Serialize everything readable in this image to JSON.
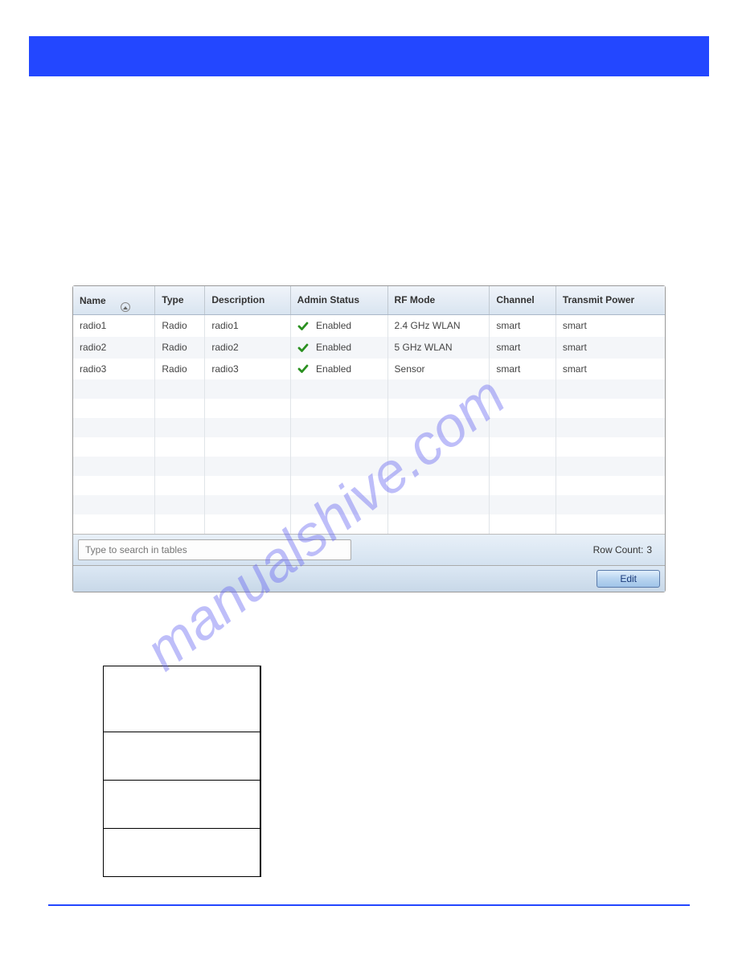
{
  "table": {
    "headers": {
      "name": "Name",
      "type": "Type",
      "description": "Description",
      "adminStatus": "Admin Status",
      "rfMode": "RF Mode",
      "channel": "Channel",
      "transmitPower": "Transmit Power"
    },
    "rows": [
      {
        "name": "radio1",
        "type": "Radio",
        "description": "radio1",
        "adminStatus": "Enabled",
        "rfMode": "2.4 GHz WLAN",
        "channel": "smart",
        "transmitPower": "smart"
      },
      {
        "name": "radio2",
        "type": "Radio",
        "description": "radio2",
        "adminStatus": "Enabled",
        "rfMode": "5 GHz WLAN",
        "channel": "smart",
        "transmitPower": "smart"
      },
      {
        "name": "radio3",
        "type": "Radio",
        "description": "radio3",
        "adminStatus": "Enabled",
        "rfMode": "Sensor",
        "channel": "smart",
        "transmitPower": "smart"
      }
    ]
  },
  "search": {
    "placeholder": "Type to search in tables"
  },
  "footer": {
    "rowCountLabel": "Row Count:",
    "rowCountValue": "3"
  },
  "buttons": {
    "edit": "Edit"
  },
  "watermark": "manualshive.com"
}
